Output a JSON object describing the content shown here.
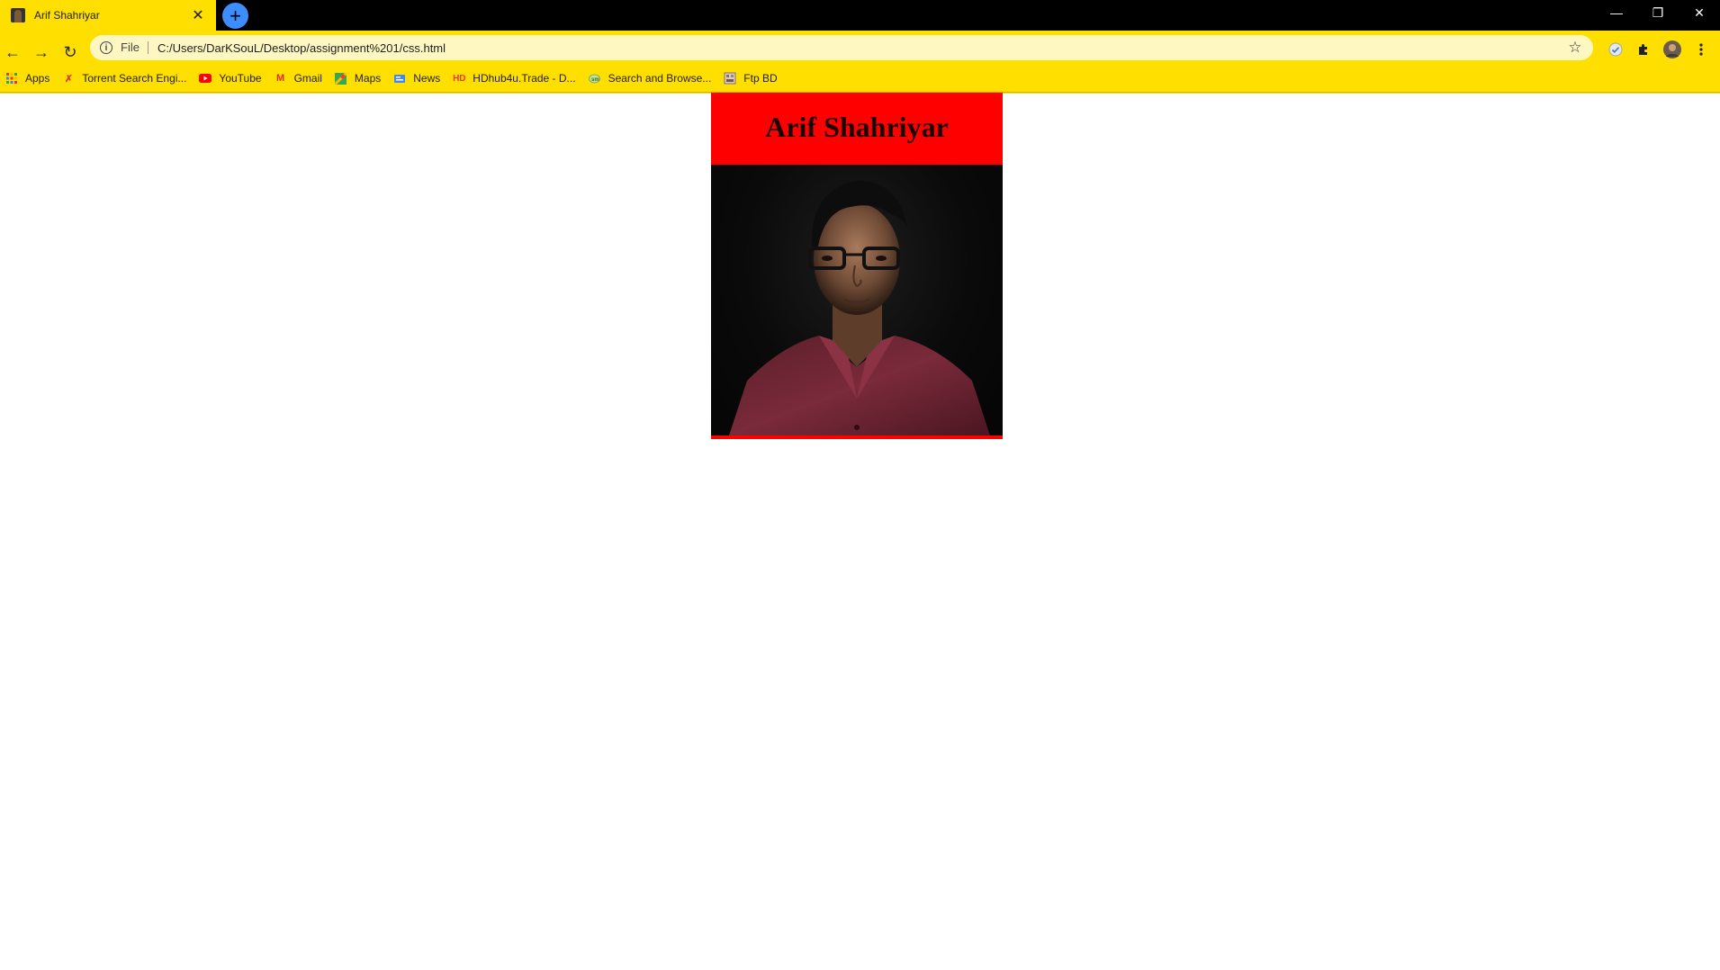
{
  "browser": {
    "tab_title": "Arif Shahriyar",
    "url_scheme": "File",
    "url": "C:/Users/DarKSouL/Desktop/assignment%201/css.html",
    "bookmarks": [
      {
        "label": "Apps",
        "icon": "apps-grid-icon",
        "color": "#e53935"
      },
      {
        "label": "Torrent Search Engi...",
        "icon": "x-icon",
        "color": "#e53935"
      },
      {
        "label": "YouTube",
        "icon": "youtube-icon",
        "color": "#ff0000"
      },
      {
        "label": "Gmail",
        "icon": "gmail-icon",
        "color": "#d93025"
      },
      {
        "label": "Maps",
        "icon": "maps-icon",
        "color": "#34a853"
      },
      {
        "label": "News",
        "icon": "news-icon",
        "color": "#4285f4"
      },
      {
        "label": "HDhub4u.Trade - D...",
        "icon": "hd-icon",
        "color": "#e53935"
      },
      {
        "label": "Search and Browse...",
        "icon": "search-browse-icon",
        "color": "#7cb342"
      },
      {
        "label": "Ftp BD",
        "icon": "ftp-icon",
        "color": "#8d6e63"
      }
    ]
  },
  "page": {
    "heading": "Arif Shahriyar",
    "card_color": "#ff0000",
    "photo_description_icon": "portrait-photo"
  }
}
